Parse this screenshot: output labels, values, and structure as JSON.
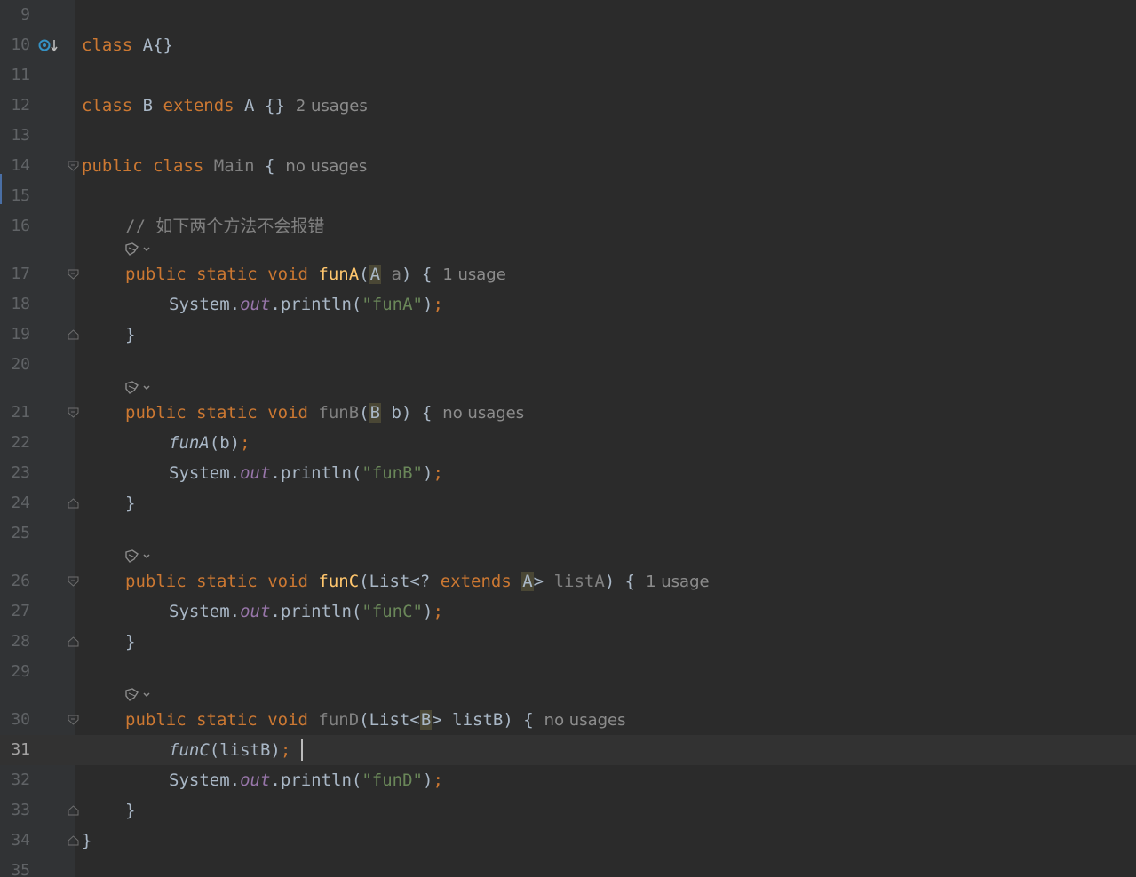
{
  "editor": {
    "lines": [
      {
        "n": "9"
      },
      {
        "n": "10",
        "parts": [
          "class",
          " A{}"
        ]
      },
      {
        "n": "11"
      },
      {
        "n": "12",
        "parts": [
          "class",
          " B ",
          "extends",
          " A ",
          "{}"
        ],
        "hint": "2 usages"
      },
      {
        "n": "13"
      },
      {
        "n": "14",
        "parts": [
          "public",
          " ",
          "class",
          " ",
          "Main",
          " {"
        ],
        "hint": "no usages"
      },
      {
        "n": "15"
      },
      {
        "n": "16",
        "comment": "// 如下两个方法不会报错"
      },
      {
        "n": "17",
        "parts": [
          "public",
          " ",
          "static",
          " ",
          "void",
          " ",
          "funA",
          "(",
          "A",
          " ",
          "a",
          ") {"
        ],
        "hint": "1 usage"
      },
      {
        "n": "18",
        "parts": [
          "System.",
          "out",
          ".println(",
          "\"funA\"",
          ")",
          ";"
        ]
      },
      {
        "n": "19",
        "parts": [
          "}"
        ]
      },
      {
        "n": "20"
      },
      {
        "n": "21",
        "parts": [
          "public",
          " ",
          "static",
          " ",
          "void",
          " ",
          "funB",
          "(",
          "B",
          " b) {"
        ],
        "hint": "no usages"
      },
      {
        "n": "22",
        "parts": [
          "funA",
          "(b)",
          ";"
        ]
      },
      {
        "n": "23",
        "parts": [
          "System.",
          "out",
          ".println(",
          "\"funB\"",
          ")",
          ";"
        ]
      },
      {
        "n": "24",
        "parts": [
          "}"
        ]
      },
      {
        "n": "25"
      },
      {
        "n": "26",
        "parts": [
          "public",
          " ",
          "static",
          " ",
          "void",
          " ",
          "funC",
          "(List<? ",
          "extends",
          " ",
          "A",
          "> ",
          "listA",
          ") {"
        ],
        "hint": "1 usage"
      },
      {
        "n": "27",
        "parts": [
          "System.",
          "out",
          ".println(",
          "\"funC\"",
          ")",
          ";"
        ]
      },
      {
        "n": "28",
        "parts": [
          "}"
        ]
      },
      {
        "n": "29"
      },
      {
        "n": "30",
        "parts": [
          "public",
          " ",
          "static",
          " ",
          "void",
          " ",
          "funD",
          "(List<",
          "B",
          "> listB) {"
        ],
        "hint": "no usages"
      },
      {
        "n": "31",
        "parts": [
          "funC",
          "(listB)",
          ";"
        ]
      },
      {
        "n": "32",
        "parts": [
          "System.",
          "out",
          ".println(",
          "\"funD\"",
          ")",
          ";"
        ]
      },
      {
        "n": "33",
        "parts": [
          "}"
        ]
      },
      {
        "n": "34",
        "parts": [
          "}"
        ]
      },
      {
        "n": "35"
      }
    ]
  },
  "colors": {
    "background": "#2b2b2b",
    "gutter": "#313335",
    "keyword": "#cc7832",
    "function": "#ffc66d",
    "string": "#6a8759",
    "field": "#9876aa",
    "text": "#a9b7c6",
    "hint": "#8c8c8c",
    "line_number": "#606366"
  },
  "icons": {
    "implemented": "implemented-icon",
    "inlay": "code-vision-icon",
    "fold": "fold-marker-icon"
  }
}
